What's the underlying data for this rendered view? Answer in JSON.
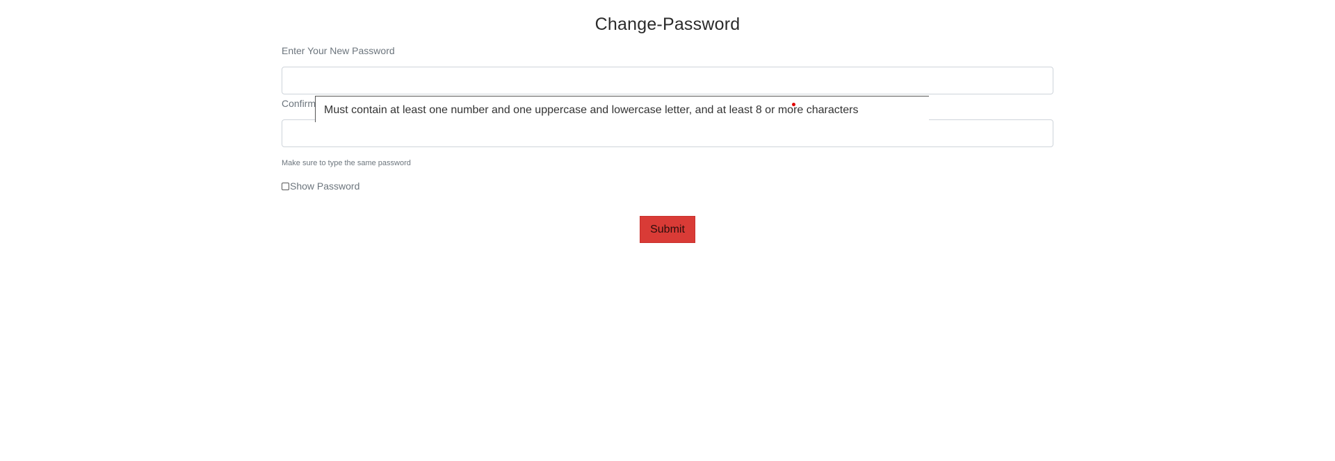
{
  "page": {
    "title": "Change-Password"
  },
  "form": {
    "new_password_label": "Enter Your New Password",
    "new_password_value": "",
    "confirm_label": "Confirm",
    "confirm_value": "",
    "help_text": "Make sure to type the same password",
    "show_password_label": "Show Password",
    "show_password_checked": false,
    "submit_label": "Submit"
  },
  "tooltip": {
    "text": "Must contain at least one number and one uppercase and lowercase letter, and at least 8 or more characters"
  },
  "colors": {
    "submit_bg": "#d93b36",
    "label_text": "#6c757d",
    "input_border": "#ced4da"
  }
}
